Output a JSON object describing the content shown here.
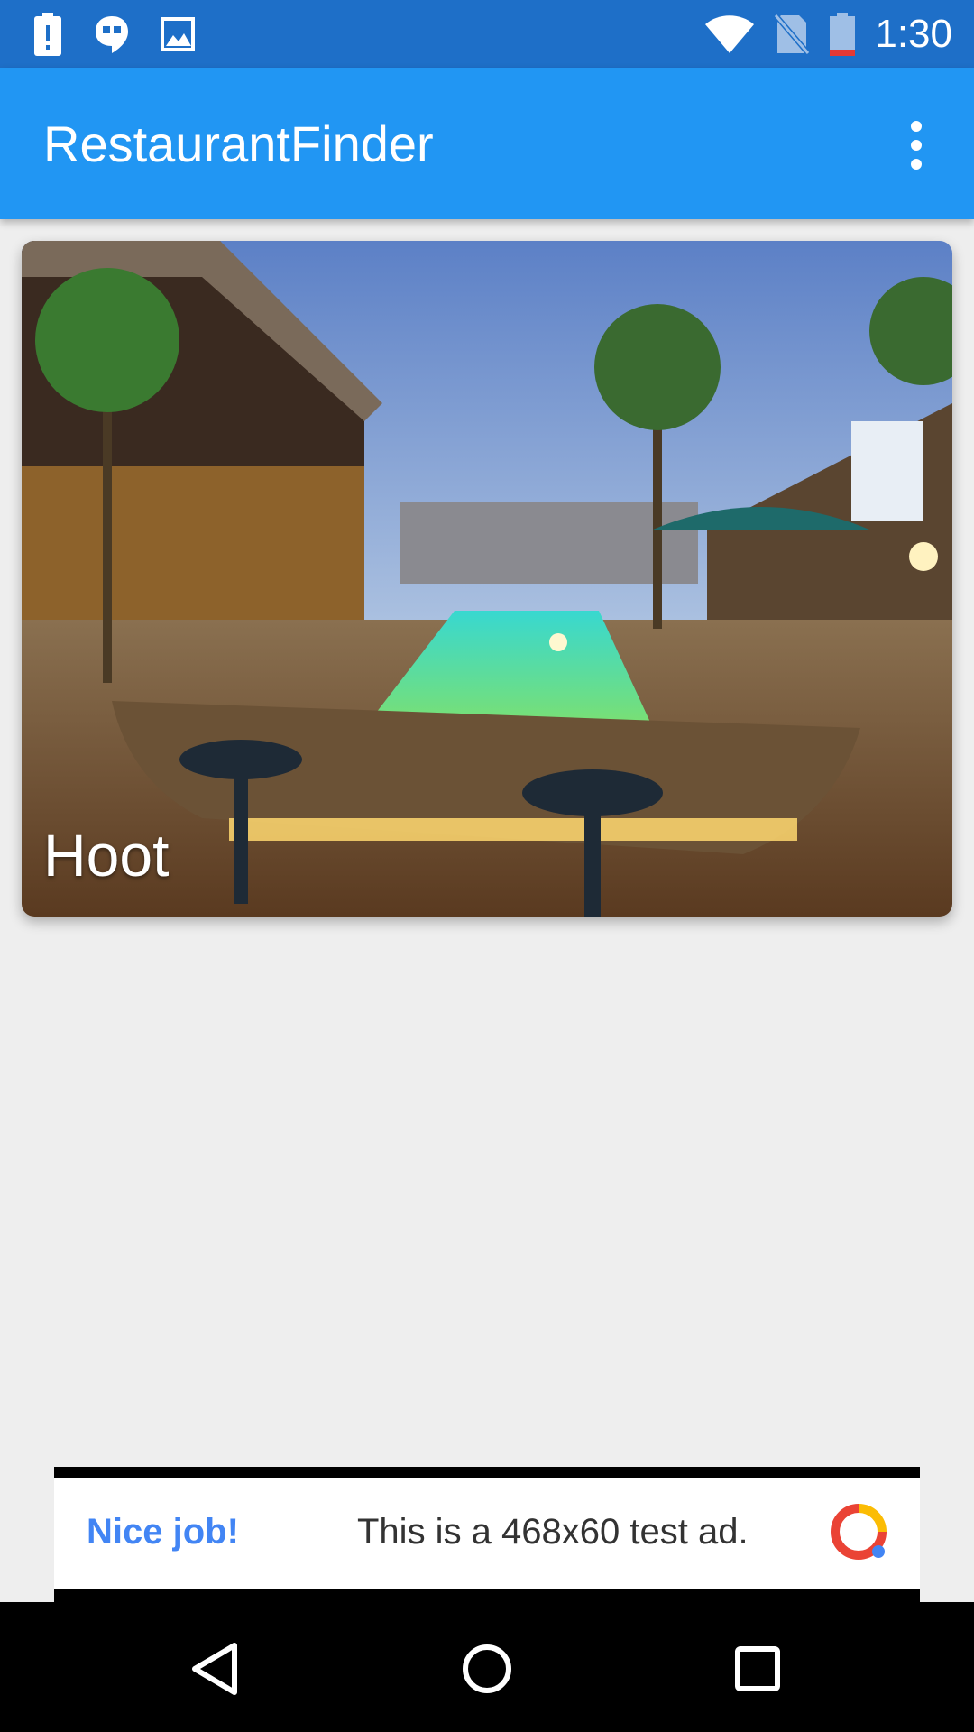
{
  "status_bar": {
    "time": "1:30",
    "left_icons": [
      "alert-icon",
      "hangouts-icon",
      "image-icon"
    ],
    "right_icons": [
      "wifi-icon",
      "no-sim-icon",
      "battery-low-icon"
    ]
  },
  "app_bar": {
    "title": "RestaurantFinder",
    "menu_icon": "more-vert-icon"
  },
  "restaurant_card": {
    "name": "Hoot"
  },
  "ad": {
    "label": "Nice job!",
    "message": "This is a 468x60 test ad."
  },
  "nav_bar": {
    "buttons": [
      "back-icon",
      "home-icon",
      "recents-icon"
    ]
  },
  "colors": {
    "status_bar": "#1e6fc8",
    "app_bar": "#2196f3",
    "background": "#eeeeee",
    "ad_accent": "#4285f4"
  }
}
